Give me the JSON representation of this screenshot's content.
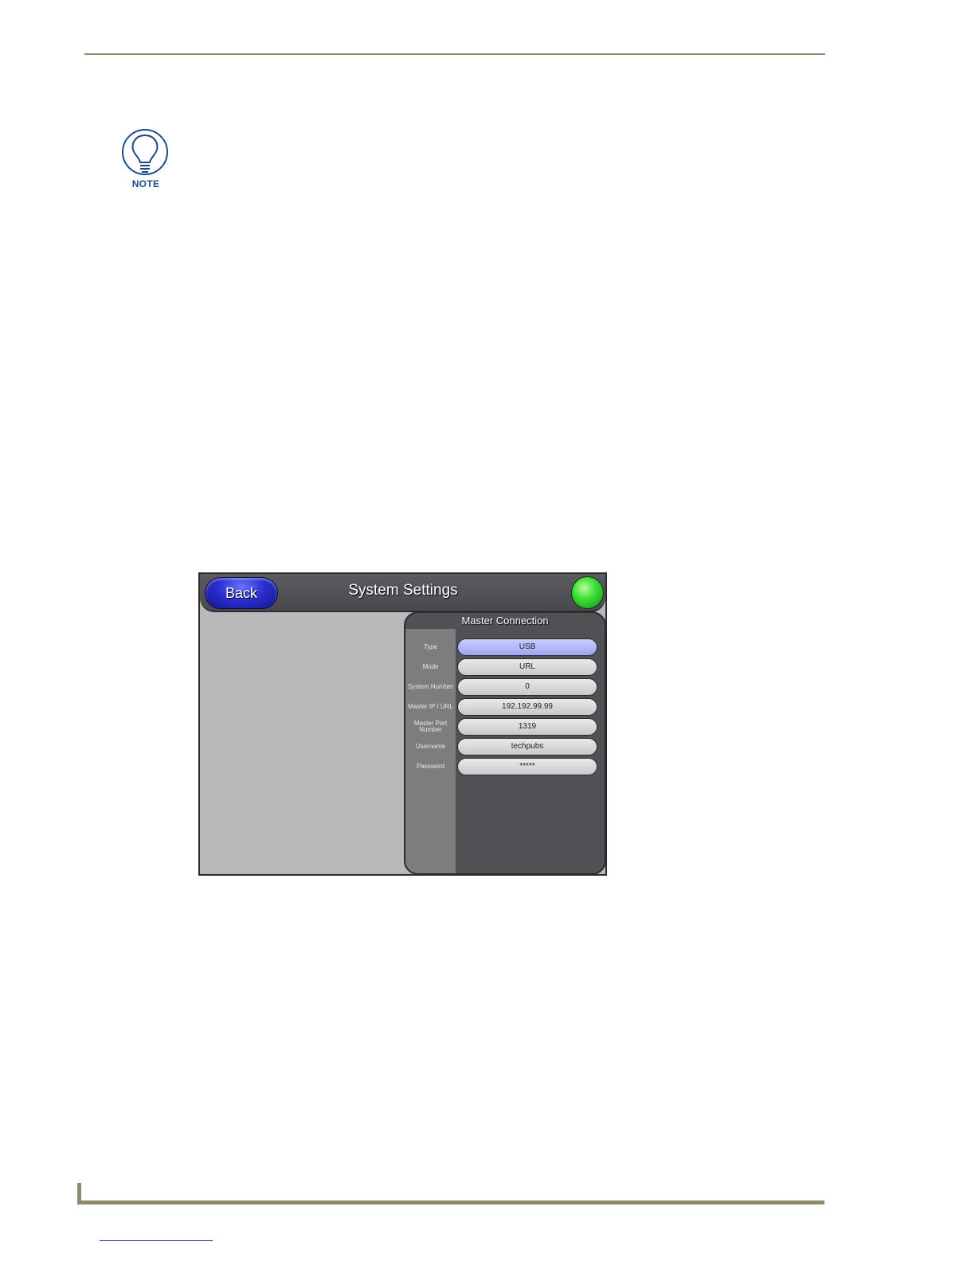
{
  "note_icon": {
    "icon": "lightbulb-icon",
    "label": "NOTE",
    "color": "#1b4a86"
  },
  "panel": {
    "back_label": "Back",
    "title": "System Settings",
    "status_icon": "green-status-led-icon",
    "master_connection": {
      "title": "Master Connection",
      "fields": [
        {
          "label": "Type",
          "value": "USB",
          "active": true
        },
        {
          "label": "Mode",
          "value": "URL",
          "active": false
        },
        {
          "label": "System Number",
          "value": "0",
          "active": false
        },
        {
          "label": "Master IP / URL",
          "value": "192.192.99.99",
          "active": false
        },
        {
          "label": "Master Port Number",
          "value": "1319",
          "active": false
        },
        {
          "label": "Username",
          "value": "techpubs",
          "active": false
        },
        {
          "label": "Password",
          "value": "*****",
          "active": false
        }
      ]
    }
  },
  "colors": {
    "rule": "#8f8a6e",
    "accent_blue": "#2b2fd0",
    "status_green": "#3ee03a"
  }
}
